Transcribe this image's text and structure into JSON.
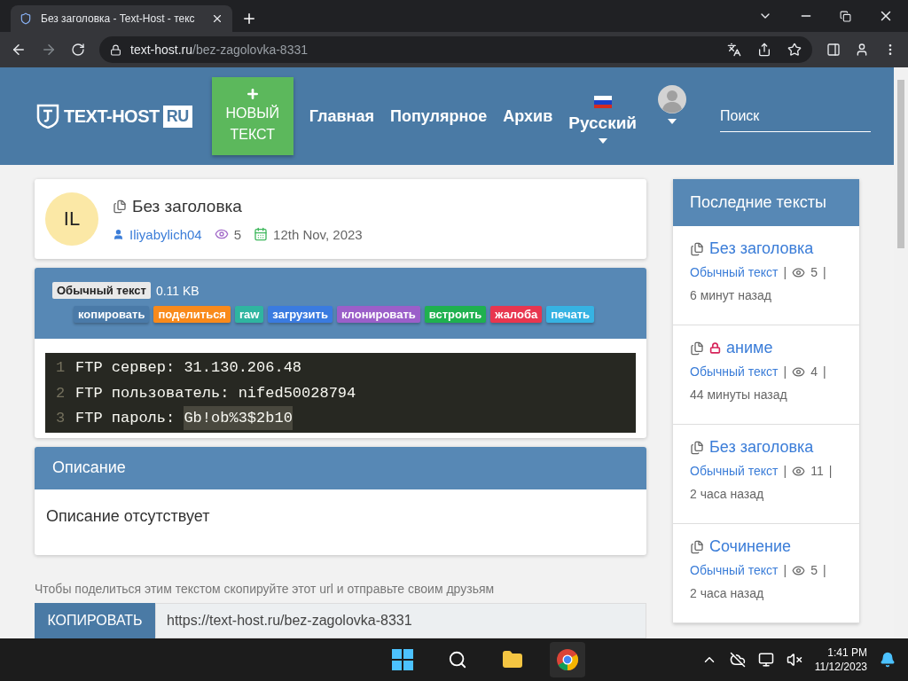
{
  "browser": {
    "tab_title": "Без заголовка - Text-Host - текс",
    "url_host": "text-host.ru",
    "url_path": "/bez-zagolovka-8331"
  },
  "header": {
    "logo": "TEXT-HOST",
    "logo_badge": "RU",
    "new_button": "НОВЫЙ ТЕКСТ",
    "nav": [
      "Главная",
      "Популярное",
      "Архив"
    ],
    "language": "Русский",
    "search": {
      "placeholder": "Поиск"
    }
  },
  "paste": {
    "avatar": "IL",
    "title": "Без заголовка",
    "author": "Iliyabylich04",
    "views": "5",
    "date": "12th Nov, 2023",
    "syntax": "Обычный текст",
    "size": "0.11 KB",
    "actions": [
      {
        "label": "копировать",
        "color": "#4a7aa8"
      },
      {
        "label": "поделиться",
        "color": "#f98a1b"
      },
      {
        "label": "raw",
        "color": "#2fb5a0"
      },
      {
        "label": "загрузить",
        "color": "#3a7be0"
      },
      {
        "label": "клонировать",
        "color": "#9b5fc9"
      },
      {
        "label": "встроить",
        "color": "#1fb14f"
      },
      {
        "label": "жалоба",
        "color": "#e8364f"
      },
      {
        "label": "печать",
        "color": "#36b3e3"
      }
    ],
    "lines": [
      {
        "number": "1",
        "text": "FTP сервер: 31.130.206.48"
      },
      {
        "number": "2",
        "text": "FTP пользователь: nifed50028794"
      },
      {
        "number": "3",
        "text": "FTP пароль: ",
        "selection": "Gb!ob%3$2b10"
      }
    ]
  },
  "description": {
    "title": "Описание",
    "text": "Описание отсутствует"
  },
  "share": {
    "hint": "Чтобы поделиться этим текстом скопируйте этот url и отправьте своим друзьям",
    "button": "КОПИРОВАТЬ",
    "url": "https://text-host.ru/bez-zagolovka-8331"
  },
  "sidebar": {
    "title": "Последние тексты",
    "items": [
      {
        "title": "Без заголовка",
        "locked": false,
        "syntax": "Обычный текст",
        "separators": [
          "|",
          "|"
        ],
        "views": "5",
        "time": "6 минут назад"
      },
      {
        "title": "аниме",
        "locked": true,
        "syntax": "Обычный текст",
        "separators": [
          "|",
          "|"
        ],
        "views": "4",
        "time": "44 минуты назад"
      },
      {
        "title": "Без заголовка",
        "locked": false,
        "syntax": "Обычный текст",
        "separators": [
          "|",
          "|"
        ],
        "views": "11",
        "time": "2 часа назад"
      },
      {
        "title": "Сочинение",
        "locked": false,
        "syntax": "Обычный текст",
        "separators": [
          "|",
          "|"
        ],
        "views": "5",
        "time": "2 часа назад"
      }
    ]
  },
  "taskbar": {
    "time": "1:41 PM",
    "date": "11/12/2023"
  }
}
